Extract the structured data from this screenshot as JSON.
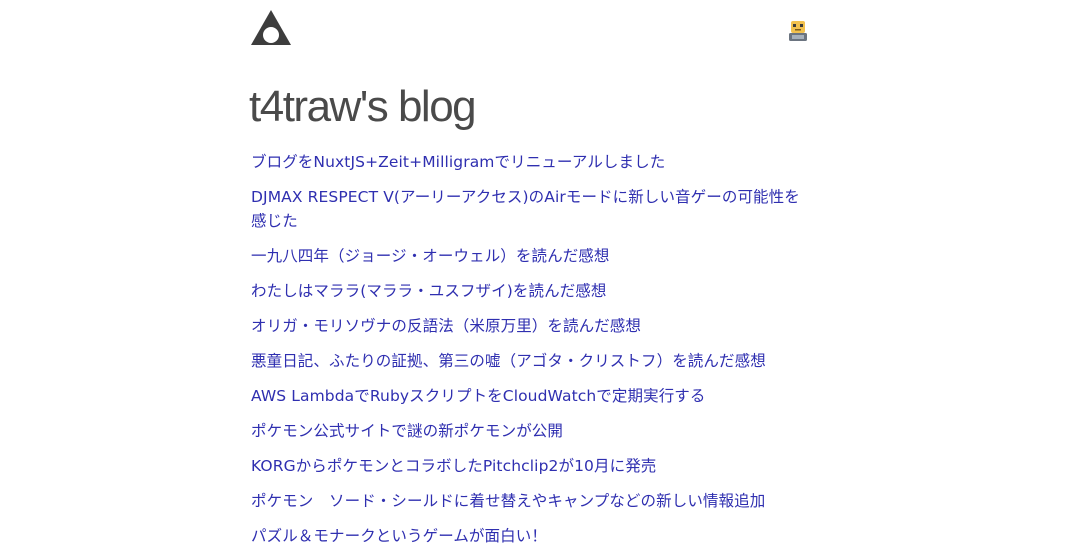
{
  "header": {
    "logo_icon": "triangle-circle-logo-icon",
    "user_icon": "robot-avatar-icon"
  },
  "blog": {
    "title": "t4traw's blog"
  },
  "posts": [
    {
      "title": "ブログをNuxtJS+Zeit+Milligramでリニューアルしました"
    },
    {
      "title": "DJMAX RESPECT V(アーリーアクセス)のAirモードに新しい音ゲーの可能性を感じた"
    },
    {
      "title": "一九八四年（ジョージ・オーウェル）を読んだ感想"
    },
    {
      "title": "わたしはマララ(マララ・ユスフザイ)を読んだ感想"
    },
    {
      "title": "オリガ・モリソヴナの反語法（米原万里）を読んだ感想"
    },
    {
      "title": "悪童日記、ふたりの証拠、第三の嘘（アゴタ・クリストフ）を読んだ感想"
    },
    {
      "title": "AWS LambdaでRubyスクリプトをCloudWatchで定期実行する"
    },
    {
      "title": "ポケモン公式サイトで謎の新ポケモンが公開"
    },
    {
      "title": "KORGからポケモンとコラボしたPitchclip2が10月に発売"
    },
    {
      "title": "ポケモン　ソード・シールドに着せ替えやキャンプなどの新しい情報追加"
    },
    {
      "title": "パズル＆モナークというゲームが面白い！"
    }
  ],
  "colors": {
    "link": "#2f2fb0",
    "title": "#4a4a4a",
    "logo": "#3d3d3d"
  }
}
